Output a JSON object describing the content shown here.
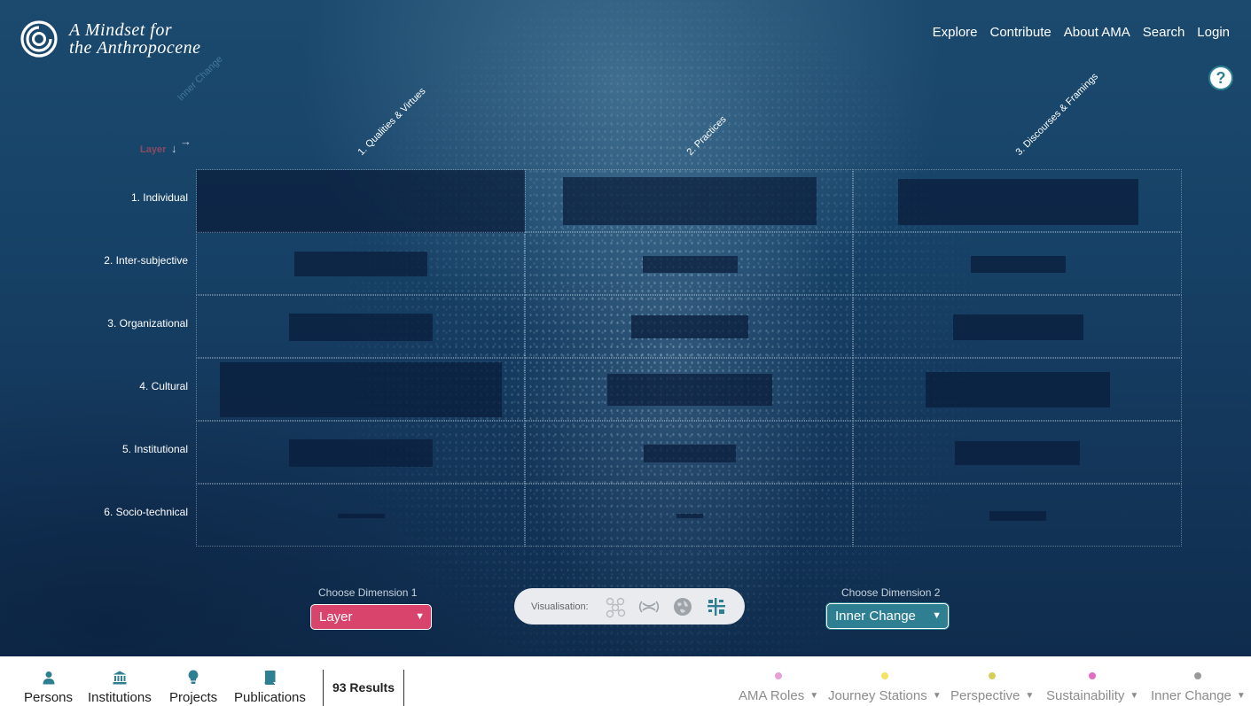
{
  "header": {
    "logo_line1": "A Mindset for",
    "logo_line2": "the Anthropocene",
    "nav": [
      "Explore",
      "Contribute",
      "About AMA",
      "Search",
      "Login"
    ],
    "help_label": "?"
  },
  "matrix": {
    "column_axis_label": "Inner Change",
    "row_axis_label": "Layer",
    "columns": [
      "1. Qualities & Virtues",
      "2. Practices",
      "3. Discourses & Framings"
    ],
    "rows": [
      "1. Individual",
      "2. Inter-subjective",
      "3. Organizational",
      "4. Cultural",
      "5. Institutional",
      "6. Socio-technical"
    ]
  },
  "controls": {
    "dimension1_label": "Choose Dimension 1",
    "dimension1_value": "Layer",
    "dimension2_label": "Choose Dimension 2",
    "dimension2_value": "Inner Change",
    "visualisation_label": "Visualisation:",
    "visualisation_icons": [
      "network-icon",
      "chord-icon",
      "globe-icon",
      "matrix-icon"
    ]
  },
  "footer": {
    "tabs": [
      "Persons",
      "Institutions",
      "Projects",
      "Publications"
    ],
    "tab_icons": [
      "person-icon",
      "institution-icon",
      "bulb-icon",
      "book-icon"
    ],
    "results": "93 Results",
    "filters": [
      {
        "label": "AMA Roles",
        "color": "#e8a0d8"
      },
      {
        "label": "Journey Stations",
        "color": "#f2e462"
      },
      {
        "label": "Perspective",
        "color": "#d7cf5a"
      },
      {
        "label": "Sustainability",
        "color": "#e36cc0"
      },
      {
        "label": "Inner Change",
        "color": "#9a9a9a"
      }
    ]
  },
  "colors": {
    "accent_layer": "#d9446c",
    "accent_inner_change": "#2f7f92"
  }
}
